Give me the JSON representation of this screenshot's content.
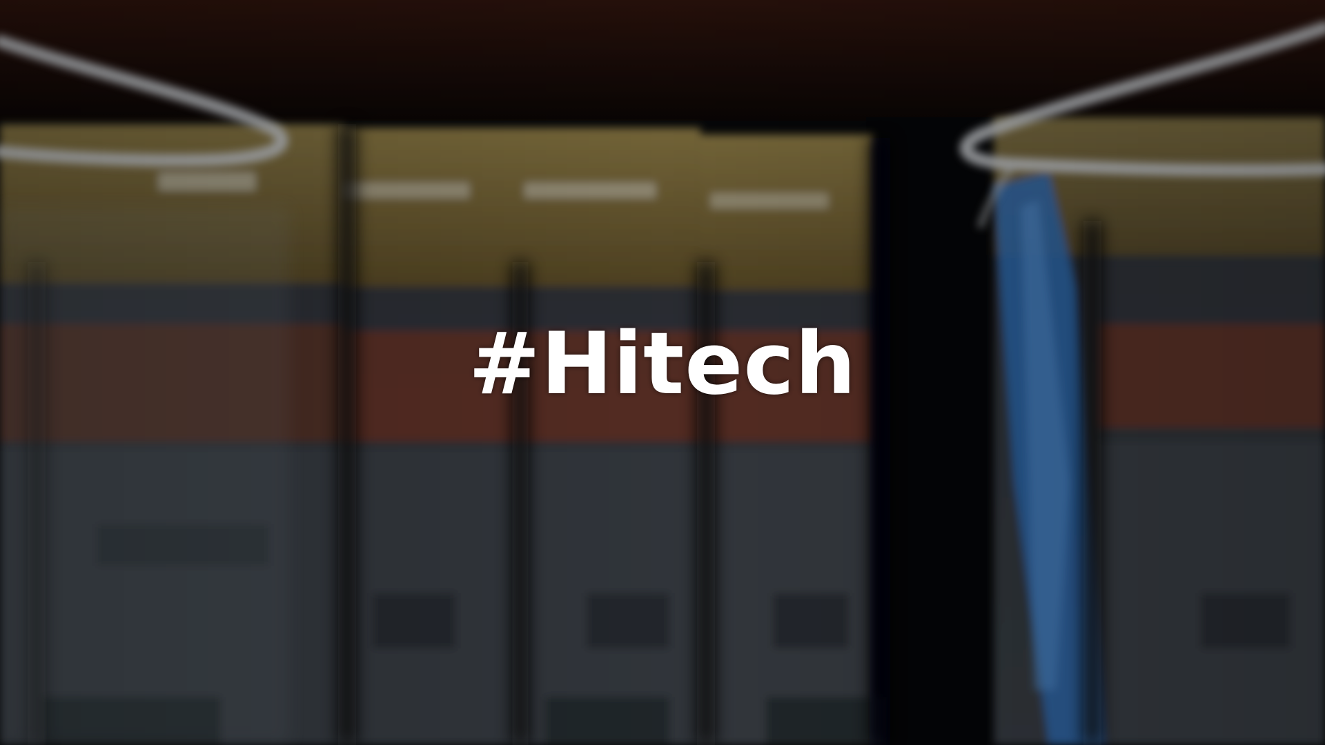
{
  "video_frame": {
    "caption": "#Hitech"
  },
  "colors": {
    "caption_text": "#ffffff",
    "background": "#07080a",
    "shelf_top": "#2a120c",
    "box_top": "#8a7437",
    "box_stripe": "#9a4a26",
    "box_body": "#2c3238",
    "hook": "#c8ccd0",
    "blue_package": "#2f6fb8"
  }
}
